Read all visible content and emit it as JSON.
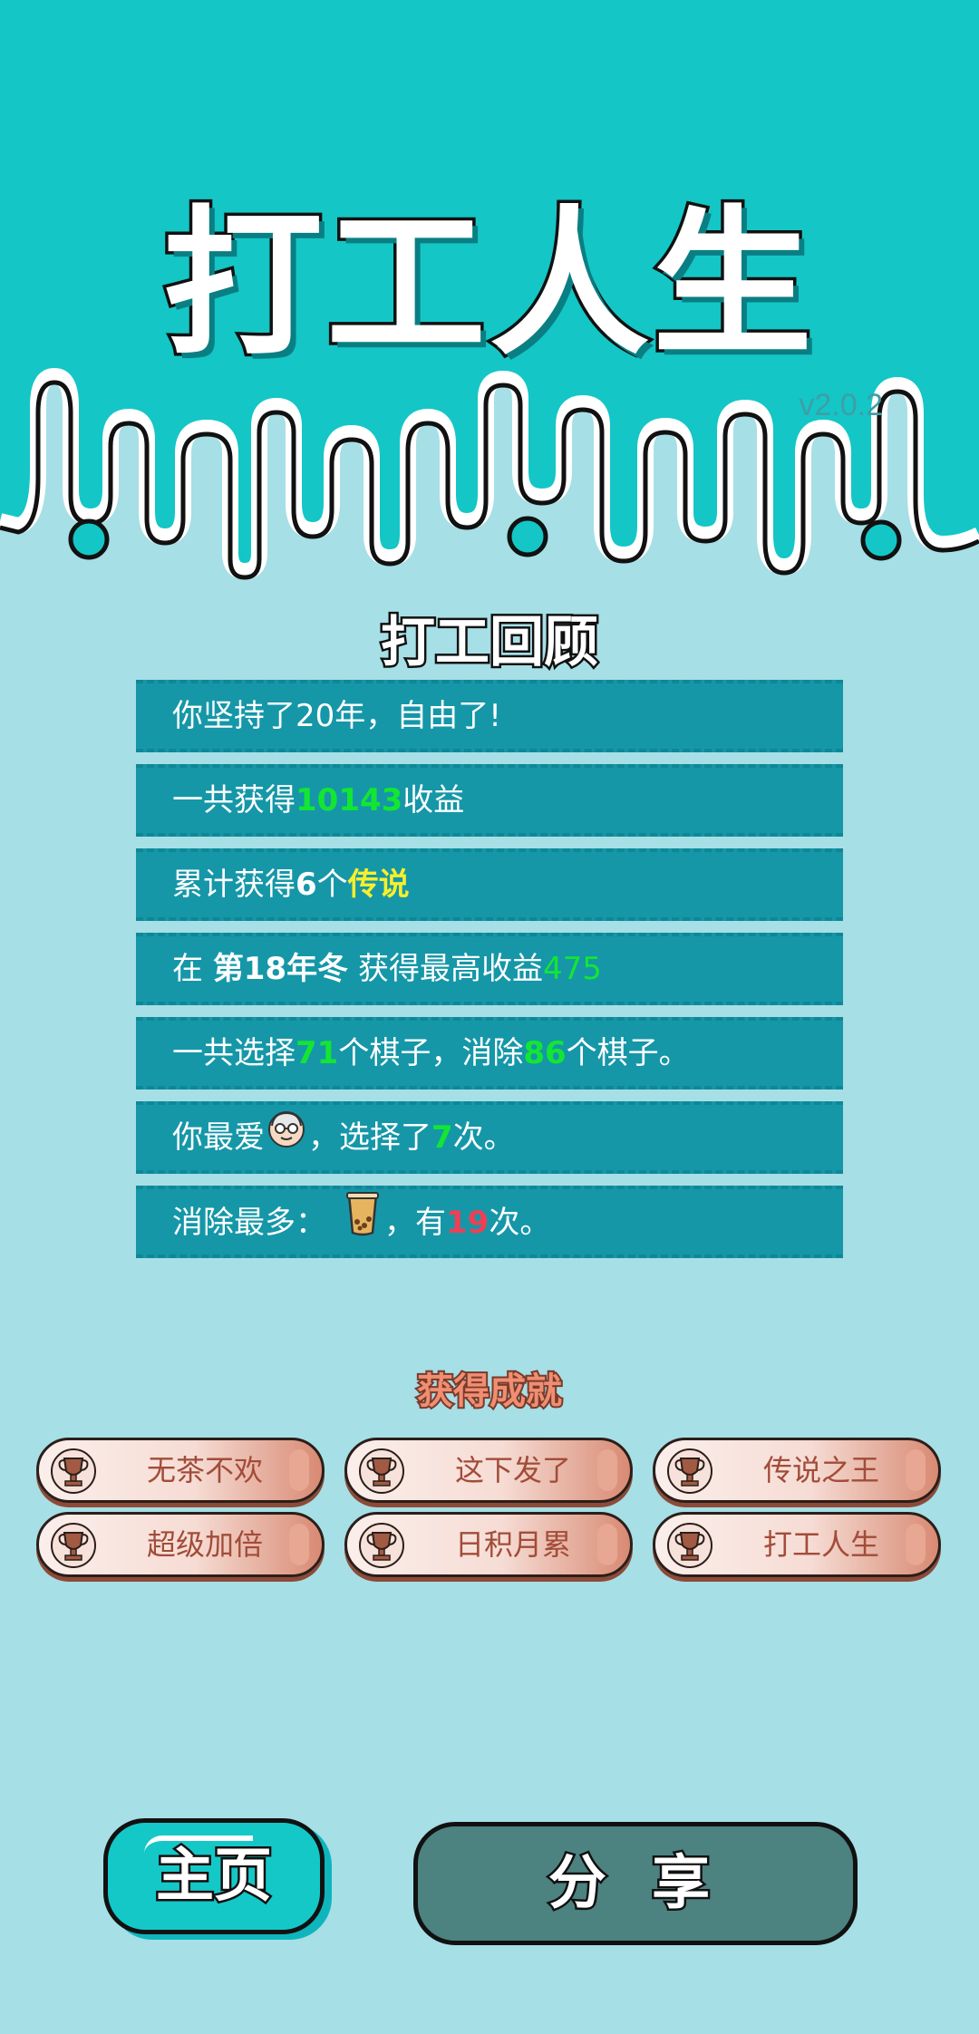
{
  "colors": {
    "background": "#a6dfe6",
    "header": "#14c6c6",
    "row": "#1597a8",
    "highlight_green": "#13e632",
    "highlight_yellow": "#f7ef2b",
    "highlight_red": "#ef3f55",
    "achievement_text": "#a24c39",
    "share_button": "#4c8280",
    "home_button": "#14c8c8"
  },
  "header": {
    "title": "打工人生",
    "version": "v2.0.2"
  },
  "review": {
    "heading": "打工回顾",
    "rows": [
      {
        "prefix": "你坚持了20年，自由了!"
      },
      {
        "prefix": "一共获得",
        "amount": "10143",
        "suffix": "收益"
      },
      {
        "prefix": "累计获得",
        "count": "6",
        "mid": "个",
        "tag": "传说"
      },
      {
        "prefix": "在 ",
        "period": "第18年冬",
        "mid": " 获得最高收益",
        "amount": "475"
      },
      {
        "prefix": "一共选择",
        "chosen": "71",
        "mid": "个棋子，消除",
        "removed": "86",
        "suffix": "个棋子。"
      },
      {
        "prefix": "你最爱",
        "icon": "old-man-face-icon",
        "mid": "，选择了",
        "times": "7",
        "suffix": "次。"
      },
      {
        "prefix": "消除最多：",
        "icon": "bubble-tea-icon",
        "mid": "，有",
        "times": "19",
        "suffix": "次。"
      }
    ]
  },
  "achievements": {
    "heading": "获得成就",
    "icon": "trophy-icon",
    "items": [
      "无茶不欢",
      "这下发了",
      "传说之王",
      "超级加倍",
      "日积月累",
      "打工人生"
    ]
  },
  "buttons": {
    "home": "主页",
    "share": "分 享"
  }
}
